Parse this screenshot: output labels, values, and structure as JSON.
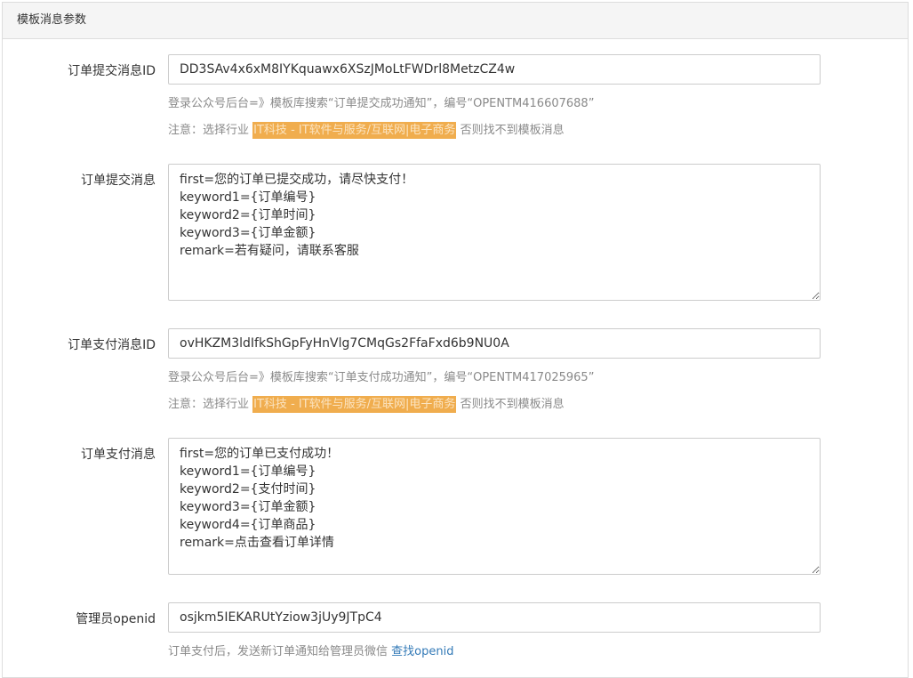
{
  "panel": {
    "title": "模板消息参数"
  },
  "submit_id": {
    "label": "订单提交消息ID",
    "value": "DD3SAv4x6xM8IYKquawx6XSzJMoLtFWDrl8MetzCZ4w",
    "help1": "登录公众号后台=》模板库搜索“订单提交成功通知”，编号“OPENTM416607688”",
    "note_prefix": "注意：选择行业",
    "note_highlight": "IT科技 - IT软件与服务/互联网|电子商务",
    "note_suffix": "否则找不到模板消息"
  },
  "submit_msg": {
    "label": "订单提交消息",
    "value": "first=您的订单已提交成功，请尽快支付！\nkeyword1={订单编号}\nkeyword2={订单时间}\nkeyword3={订单金额}\nremark=若有疑问，请联系客服"
  },
  "pay_id": {
    "label": "订单支付消息ID",
    "value": "ovHKZM3ldIfkShGpFyHnVlg7CMqGs2FfaFxd6b9NU0A",
    "help1": "登录公众号后台=》模板库搜索“订单支付成功通知”，编号“OPENTM417025965”",
    "note_prefix": "注意：选择行业",
    "note_highlight": "IT科技 - IT软件与服务/互联网|电子商务",
    "note_suffix": "否则找不到模板消息"
  },
  "pay_msg": {
    "label": "订单支付消息",
    "value": "first=您的订单已支付成功！\nkeyword1={订单编号}\nkeyword2={支付时间}\nkeyword3={订单金额}\nkeyword4={订单商品}\nremark=点击查看订单详情"
  },
  "admin_openid": {
    "label": "管理员openid",
    "value": "osjkm5IEKARUtYziow3jUy9JTpC4",
    "help_text": "订单支付后，发送新订单通知给管理员微信",
    "help_link": "查找openid"
  }
}
